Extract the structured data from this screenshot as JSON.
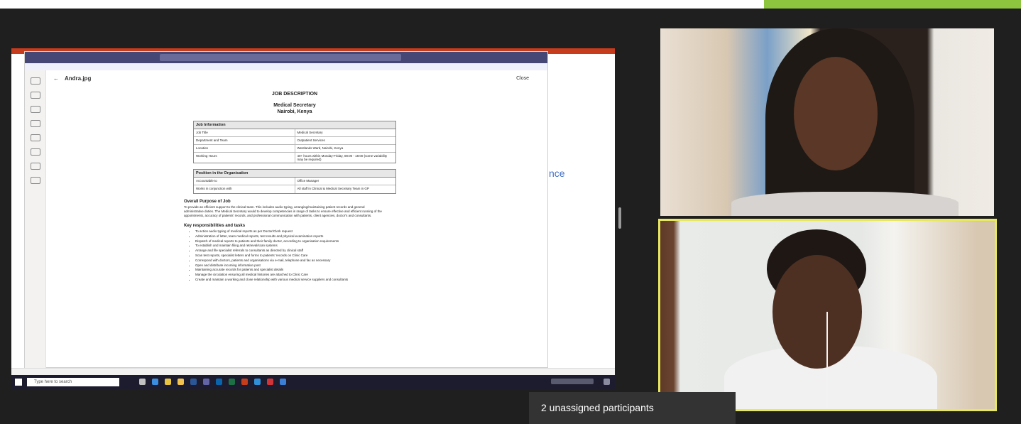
{
  "colors": {
    "accent_green": "#8dc53e",
    "speaker_highlight": "#e8e860",
    "teams_purple": "#464775"
  },
  "meeting": {
    "unassigned_banner": "2 unassigned participants"
  },
  "shared_screen": {
    "viewer": {
      "file_name": "Andra.jpg",
      "close_label": "Close"
    },
    "document": {
      "title": "JOB DESCRIPTION",
      "role": "Medical Secretary",
      "location": "Nairobi, Kenya",
      "job_info": {
        "header": "Job Information",
        "rows": [
          {
            "label": "Job Title",
            "value": "Medical Secretary"
          },
          {
            "label": "Department and Team",
            "value": "Outpatient Services"
          },
          {
            "label": "Location",
            "value": "Westlands Ward, Nairobi, Kenya"
          },
          {
            "label": "Working Hours",
            "value": "40+ hours within Monday-Friday, 08:00 - 18:00 (some variability may be required)"
          }
        ]
      },
      "position": {
        "header": "Position in the Organisation",
        "rows": [
          {
            "label": "Accountable to",
            "value": "Office Manager"
          },
          {
            "label": "Works in conjunction with",
            "value": "All staff in Clinical & Medical Secretary Team in GP"
          }
        ]
      },
      "purpose": {
        "title": "Overall Purpose of Job",
        "text": "To provide an efficient support to the clinical team. This includes audio typing, arranging/maintaining patient records and general administrative duties. The Medical Secretary would to develop competencies in range of tasks to ensure effective and efficient running of the appointments, accuracy of patients' records, and professional communication with patients, client agencies, doctor's and consultants."
      },
      "responsibilities": {
        "title": "Key responsibilities and tasks",
        "items": [
          "To action audio typing of medical reports as per Doctor/Clerk request",
          "Administration of letter, team medical reports, test results and physical examination reports",
          "Dispatch of medical reports to patients and their family doctor, according to organisation requirements",
          "To establish and maintain filing and retrieval/scan systems",
          "Arrange and file specialist referrals to consultants as directed by clinical staff",
          "Scan test reports, specialist letters and forms to patients' records on Clinic Care",
          "Correspond with doctors, patients and organisations via e-mail, telephone and fax as necessary",
          "Open and distribute incoming information post",
          "Maintaining accurate records for patients and specialist details",
          "Manage the circulation ensuring all medical histories are attached to Clinic Care",
          "Create and maintain a working and close relationship with various medical service suppliers and consultants"
        ]
      }
    },
    "side_fragment": "nce",
    "taskbar": {
      "search_placeholder": "Type here to search"
    }
  }
}
